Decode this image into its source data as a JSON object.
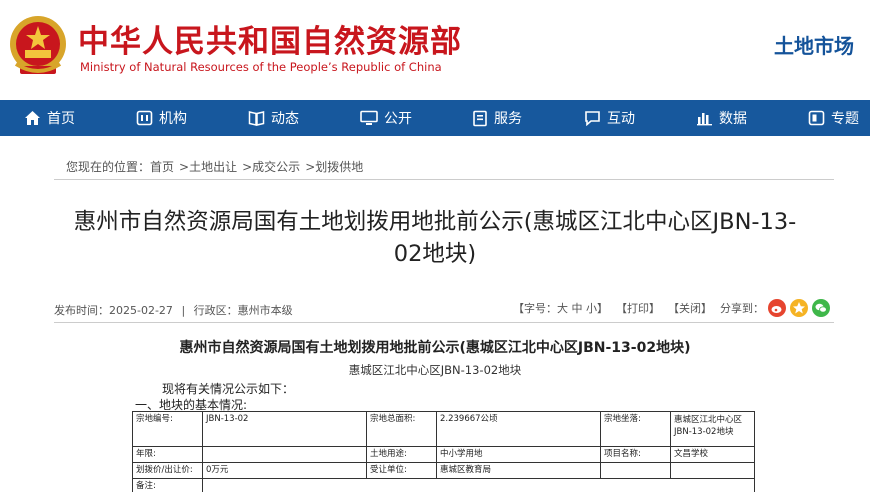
{
  "header": {
    "ministry_cn": "中华人民共和国自然资源部",
    "ministry_en": "Ministry of Natural Resources of the People’s Republic of China",
    "section": "土地市场"
  },
  "nav": {
    "items": [
      {
        "label": "首页",
        "icon": "home-icon"
      },
      {
        "label": "机构",
        "icon": "institution-icon"
      },
      {
        "label": "动态",
        "icon": "book-icon"
      },
      {
        "label": "公开",
        "icon": "monitor-icon"
      },
      {
        "label": "服务",
        "icon": "document-icon"
      },
      {
        "label": "互动",
        "icon": "chat-icon"
      },
      {
        "label": "数据",
        "icon": "bar-chart-icon"
      },
      {
        "label": "专题",
        "icon": "album-icon"
      }
    ]
  },
  "breadcrumb": {
    "prefix": "您现在的位置：",
    "items": [
      "首页",
      "土地出让",
      "成交公示",
      "划拨供地"
    ],
    "separator": ">"
  },
  "article": {
    "title_line1": "惠州市自然资源局国有土地划拨用地批前公示(惠城区江北中心区JBN-13-",
    "title_line2": "02地块)",
    "publish_label": "发布时间：",
    "publish_date": "2025-02-27",
    "region_label": "行政区：",
    "region": "惠州市本级",
    "font_label": "【字号：",
    "font_sizes": [
      "大",
      "中",
      "小"
    ],
    "font_close": "】",
    "print": "【打印】",
    "close": "【关闭】",
    "share_label": "分享到："
  },
  "doc": {
    "title": "惠州市自然资源局国有土地划拨用地批前公示(惠城区江北中心区JBN-13-02地块)",
    "subtitle": "惠城区江北中心区JBN-13-02地块",
    "intro": "现将有关情况公示如下：",
    "section1": "一、地块的基本情况:"
  },
  "table": {
    "rows": [
      [
        "宗地编号:",
        "JBN-13-02",
        "宗地总面积:",
        "2.239667公顷",
        "宗地坐落:",
        "惠城区江北中心区JBN-13-02地块"
      ],
      [
        "年限:",
        "",
        "土地用途:",
        "中小学用地",
        "项目名称:",
        "文昌学校"
      ],
      [
        "划拨价/出让价:",
        "0万元",
        "受让单位:",
        "惠城区教育局",
        "",
        ""
      ],
      [
        "备注:",
        "",
        "",
        "",
        "",
        ""
      ]
    ]
  },
  "colors": {
    "brand_red": "#c8161d",
    "nav_blue": "#17589d",
    "section_blue": "#14539a"
  }
}
